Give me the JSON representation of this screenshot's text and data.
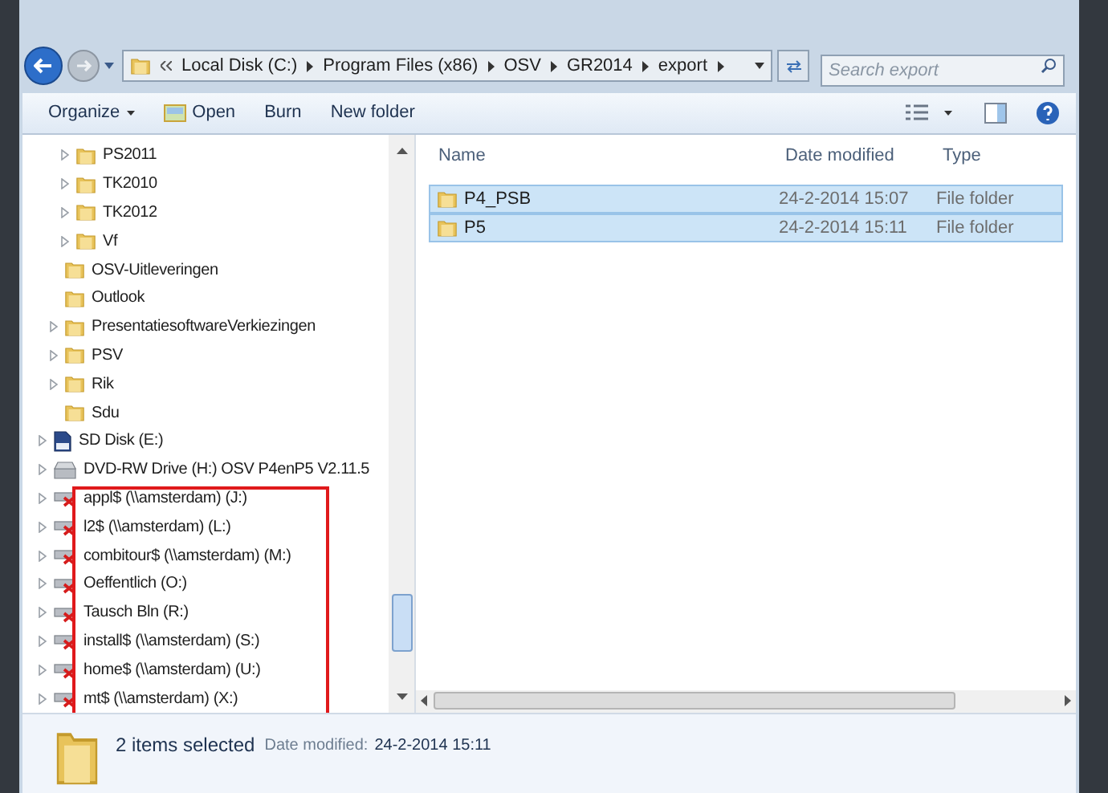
{
  "address_bar": {
    "segments": [
      "Local Disk (C:)",
      "Program Files (x86)",
      "OSV",
      "GR2014",
      "export"
    ]
  },
  "search": {
    "placeholder": "Search export"
  },
  "toolbar": {
    "buttons": [
      {
        "label": "Organize",
        "kind": "menu"
      },
      {
        "label": "Open",
        "kind": "icon"
      },
      {
        "label": "Burn",
        "kind": "plain"
      },
      {
        "label": "New folder",
        "kind": "plain"
      }
    ]
  },
  "nav_tree": [
    {
      "children": [
        {
          "children": [
            {
              "label": "PS2011",
              "kind": "folder",
              "expandable": true,
              "highlighted": false
            },
            {
              "label": "TK2010",
              "kind": "folder",
              "expandable": true,
              "highlighted": false
            },
            {
              "label": "TK2012",
              "kind": "folder",
              "expandable": true,
              "highlighted": false
            },
            {
              "label": "Vf",
              "kind": "folder",
              "expandable": true,
              "highlighted": false
            }
          ]
        },
        {
          "label": "OSV-Uitleveringen",
          "kind": "folder",
          "expandable": false,
          "highlighted": false
        },
        {
          "label": "Outlook",
          "kind": "folder",
          "expandable": false,
          "highlighted": false
        },
        {
          "label": "PresentatiesoftwareVerkiezingen",
          "kind": "folder",
          "expandable": true,
          "highlighted": false
        },
        {
          "label": "PSV",
          "kind": "folder",
          "expandable": true,
          "highlighted": false
        },
        {
          "label": "Rik",
          "kind": "folder",
          "expandable": true,
          "highlighted": false
        },
        {
          "label": "Sdu",
          "kind": "folder",
          "expandable": false,
          "highlighted": false
        }
      ]
    },
    {
      "label": "SD Disk (E:)",
      "kind": "sd",
      "expandable": true,
      "highlighted": false
    },
    {
      "label": "DVD-RW Drive (H:) OSV P4enP5 V2.11.5",
      "kind": "dvd",
      "expandable": true,
      "highlighted": false
    },
    {
      "label": "appl$ (\\\\amsterdam) (J:)",
      "kind": "network",
      "expandable": true,
      "highlighted": true
    },
    {
      "label": "l2$ (\\\\amsterdam) (L:)",
      "kind": "network",
      "expandable": true,
      "highlighted": true
    },
    {
      "label": "combitour$ (\\\\amsterdam) (M:)",
      "kind": "network",
      "expandable": true,
      "highlighted": true
    },
    {
      "label": "Oeffentlich (O:)",
      "kind": "network",
      "expandable": true,
      "highlighted": true
    },
    {
      "label": "Tausch Bln (R:)",
      "kind": "network",
      "expandable": true,
      "highlighted": true
    },
    {
      "label": "install$ (\\\\amsterdam) (S:)",
      "kind": "network",
      "expandable": true,
      "highlighted": true
    },
    {
      "label": "home$ (\\\\amsterdam) (U:)",
      "kind": "network",
      "expandable": true,
      "highlighted": true
    },
    {
      "label": "mt$ (\\\\amsterdam) (X:)",
      "kind": "network",
      "expandable": true,
      "highlighted": true
    }
  ],
  "file_list": {
    "columns": [
      "Name",
      "Date modified",
      "Type"
    ],
    "rows": [
      {
        "name": "P4_PSB",
        "date": "24-2-2014 15:07",
        "type": "File folder",
        "selected": true
      },
      {
        "name": "P5",
        "date": "24-2-2014 15:11",
        "type": "File folder",
        "selected": true
      }
    ]
  },
  "details": {
    "summary": "2 items selected",
    "date_label": "Date modified:",
    "date_value": "24-2-2014 15:11"
  }
}
